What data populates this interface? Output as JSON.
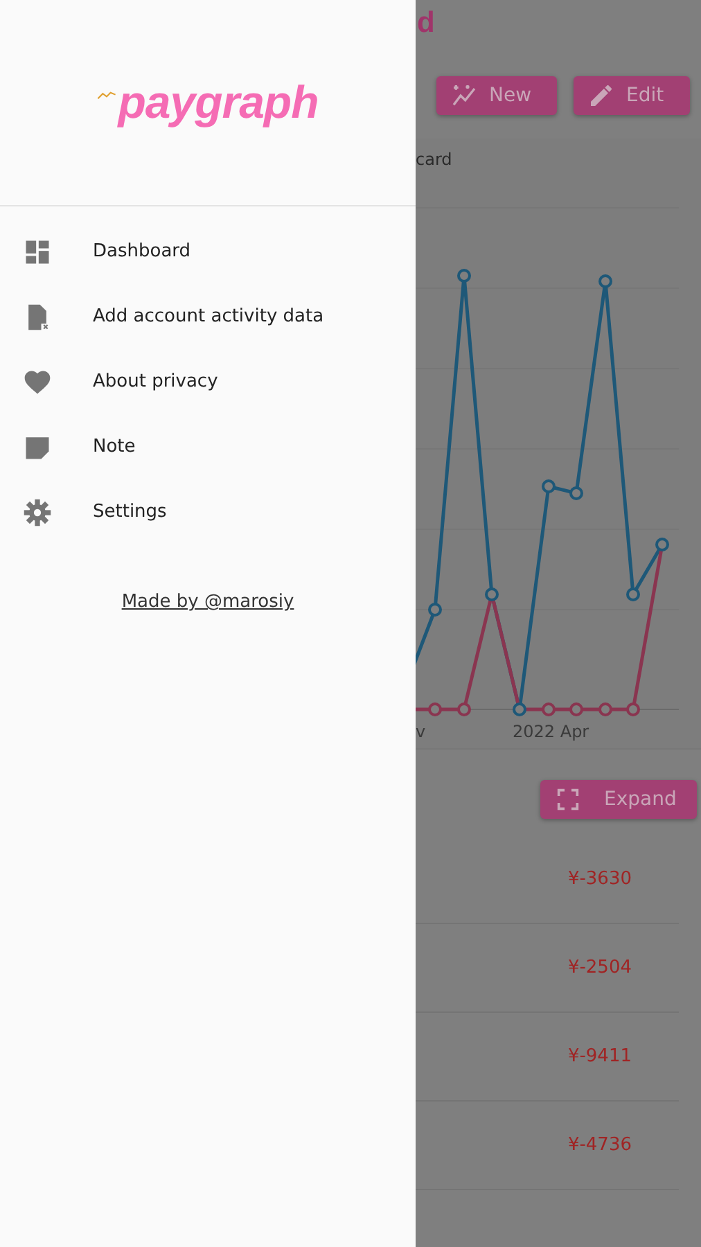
{
  "drawer": {
    "logo": "paygraph",
    "items": [
      {
        "label": "Dashboard"
      },
      {
        "label": "Add account activity data"
      },
      {
        "label": "About privacy"
      },
      {
        "label": "Note"
      },
      {
        "label": "Settings"
      }
    ],
    "credit_link": "Made by @marosiy"
  },
  "background": {
    "title_fragment": "d",
    "buttons": [
      {
        "label": "New"
      },
      {
        "label": "Edit"
      }
    ],
    "legend_fragment": "card",
    "x_labels": [
      "v",
      "2022 Apr"
    ],
    "expand_button": "Expand",
    "amounts": [
      "¥-3630",
      "¥-2504",
      "¥-9411",
      "¥-4736"
    ]
  }
}
